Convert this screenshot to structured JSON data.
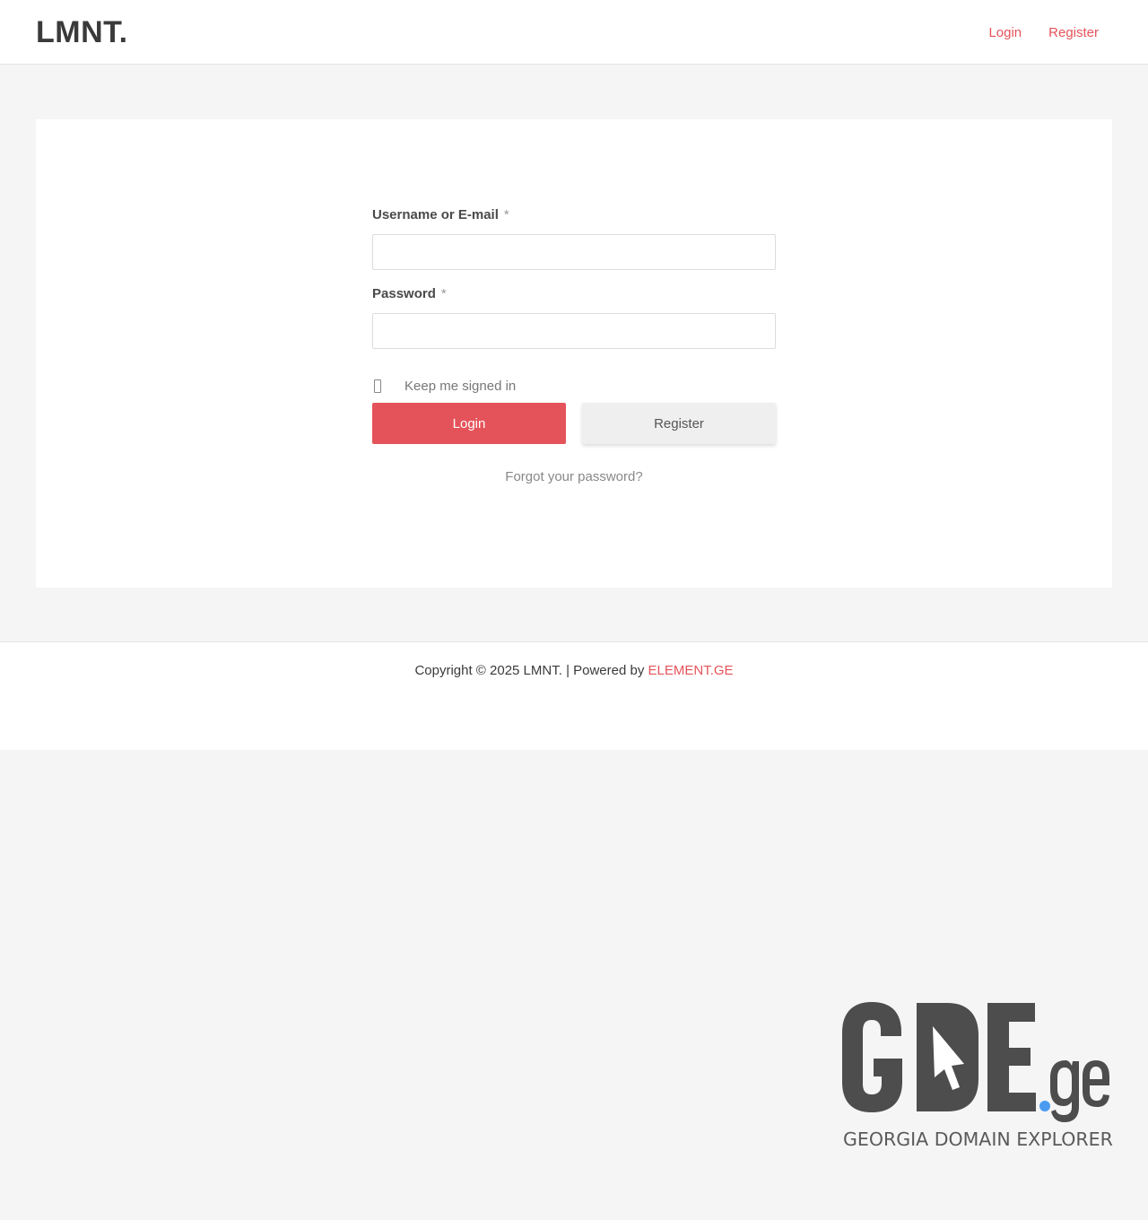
{
  "header": {
    "site_title": "LMNT.",
    "nav": [
      {
        "label": "Login"
      },
      {
        "label": "Register"
      }
    ]
  },
  "form": {
    "username_label": "Username or E-mail",
    "password_label": "Password",
    "required_mark": "*",
    "username_value": "",
    "password_value": "",
    "remember_label": "Keep me signed in",
    "login_button": "Login",
    "register_button": "Register",
    "forgot_link": "Forgot your password?"
  },
  "footer": {
    "copyright_text": "Copyright © 2025 LMNT. | Powered by ",
    "powered_link": "ELEMENT.GE"
  },
  "badge": {
    "brand": "GDE",
    "tld": ".ge",
    "tagline": "GEORGIA DOMAIN EXPLORER",
    "icon": "cursor-arrow-icon"
  },
  "colors": {
    "accent": "#e5535a",
    "text": "#3a3a3a",
    "background": "#f5f5f5",
    "logo_gray": "#4d4d4d",
    "logo_dot": "#4b9cf0"
  }
}
